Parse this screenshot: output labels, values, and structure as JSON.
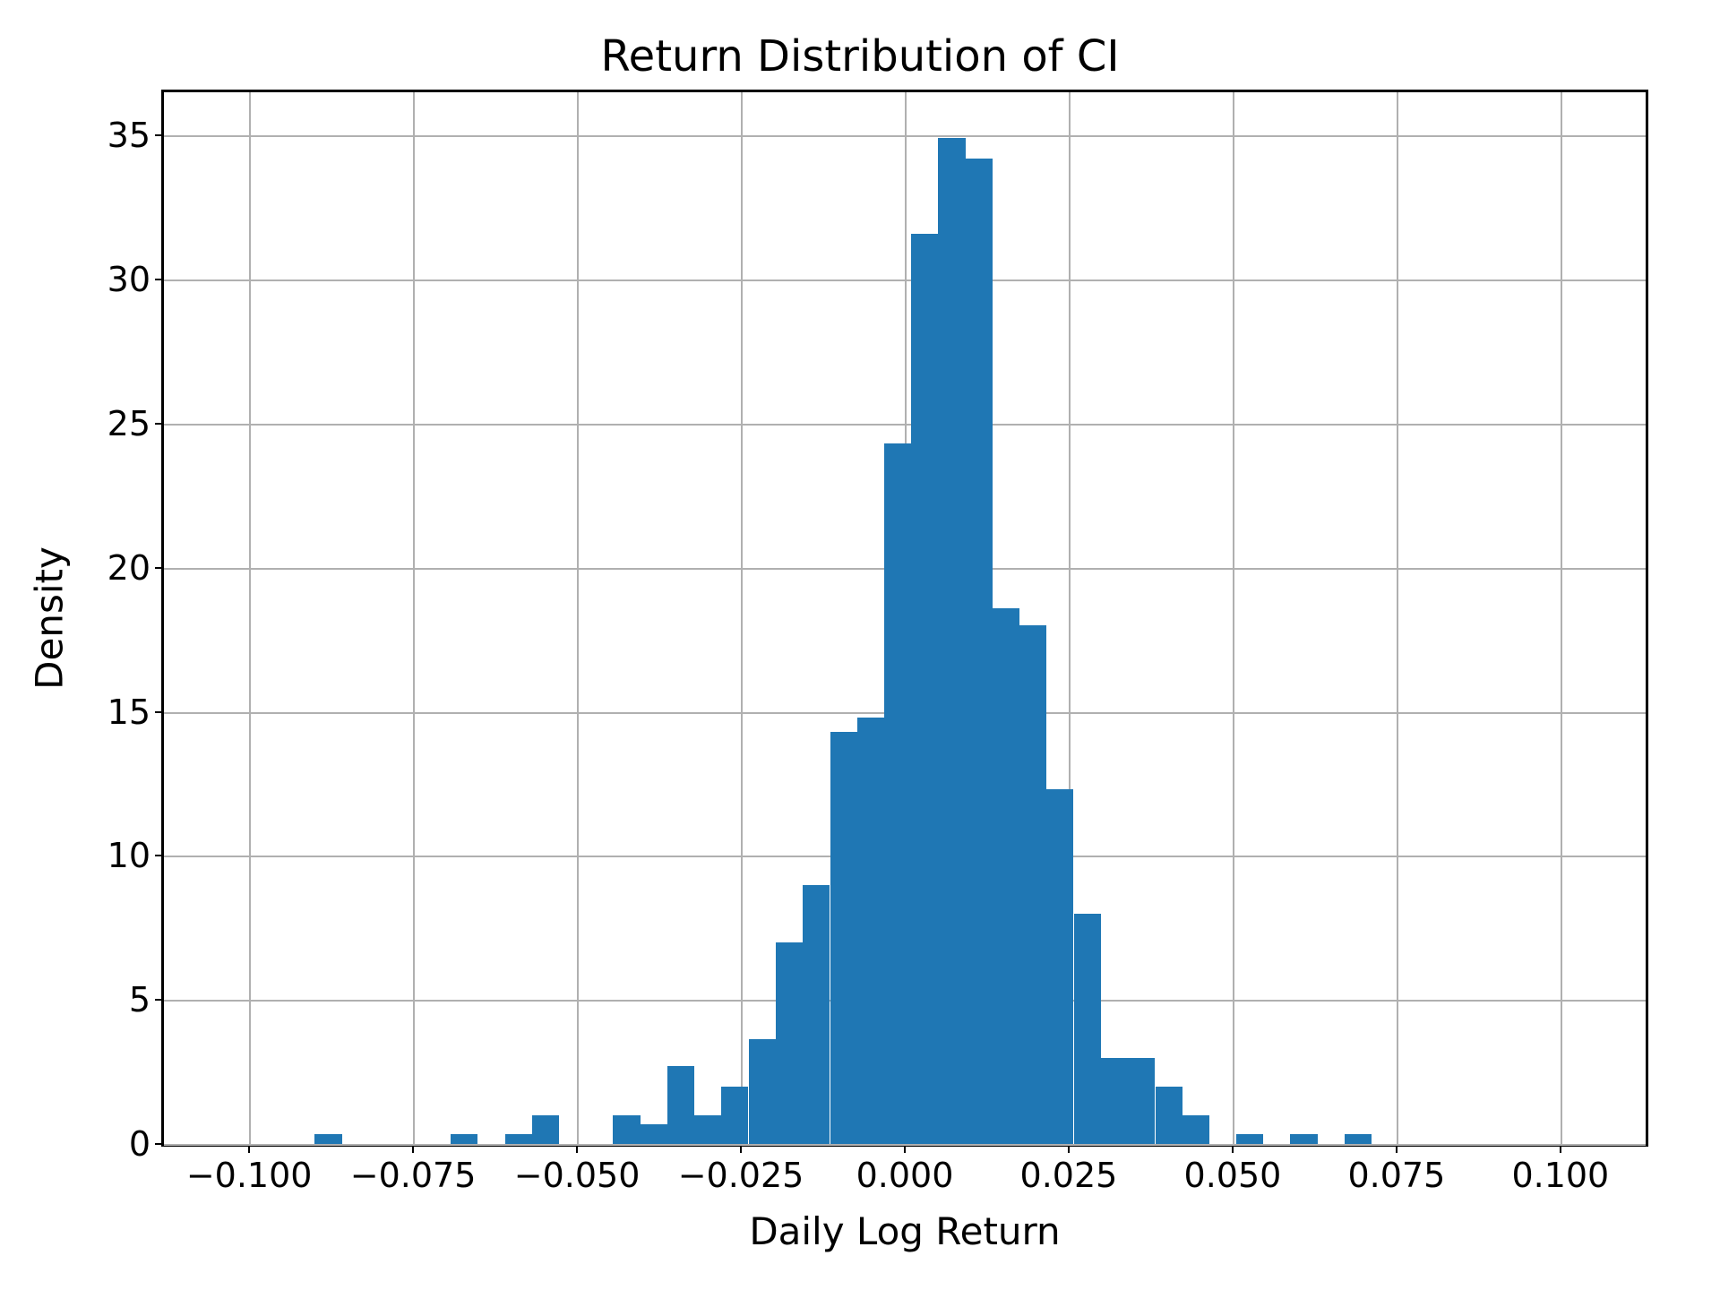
{
  "chart_data": {
    "type": "bar",
    "title": "Return Distribution of CI",
    "xlabel": "Daily Log Return",
    "ylabel": "Density",
    "xlim": [
      -0.113,
      0.113
    ],
    "ylim": [
      0,
      36.5
    ],
    "xticks": [
      -0.1,
      -0.075,
      -0.05,
      -0.025,
      0.0,
      0.025,
      0.05,
      0.075,
      0.1
    ],
    "xtick_labels": [
      "−0.100",
      "−0.075",
      "−0.050",
      "−0.025",
      "0.000",
      "0.025",
      "0.050",
      "0.075",
      "0.100"
    ],
    "yticks": [
      0,
      5,
      10,
      15,
      20,
      25,
      30,
      35
    ],
    "bar_color": "#1f77b4",
    "bin_width": 0.00413,
    "bins": [
      {
        "x": -0.09,
        "density": 0.35
      },
      {
        "x": -0.0693,
        "density": 0.35
      },
      {
        "x": -0.061,
        "density": 0.35
      },
      {
        "x": -0.0569,
        "density": 1.0
      },
      {
        "x": -0.0445,
        "density": 1.0
      },
      {
        "x": -0.0404,
        "density": 0.7
      },
      {
        "x": -0.0362,
        "density": 2.7
      },
      {
        "x": -0.0321,
        "density": 1.0
      },
      {
        "x": -0.028,
        "density": 2.0
      },
      {
        "x": -0.0238,
        "density": 3.65
      },
      {
        "x": -0.0197,
        "density": 7.0
      },
      {
        "x": -0.0156,
        "density": 9.0
      },
      {
        "x": -0.0114,
        "density": 14.3
      },
      {
        "x": -0.0073,
        "density": 14.8
      },
      {
        "x": -0.0032,
        "density": 24.3
      },
      {
        "x": 0.001,
        "density": 31.6
      },
      {
        "x": 0.0051,
        "density": 34.9
      },
      {
        "x": 0.0092,
        "density": 34.2
      },
      {
        "x": 0.0134,
        "density": 18.6
      },
      {
        "x": 0.0175,
        "density": 18.0
      },
      {
        "x": 0.0216,
        "density": 12.3
      },
      {
        "x": 0.0258,
        "density": 8.0
      },
      {
        "x": 0.0299,
        "density": 3.0
      },
      {
        "x": 0.034,
        "density": 3.0
      },
      {
        "x": 0.0382,
        "density": 2.0
      },
      {
        "x": 0.0423,
        "density": 1.0
      },
      {
        "x": 0.0505,
        "density": 0.35
      },
      {
        "x": 0.0588,
        "density": 0.35
      },
      {
        "x": 0.0671,
        "density": 0.35
      }
    ]
  }
}
